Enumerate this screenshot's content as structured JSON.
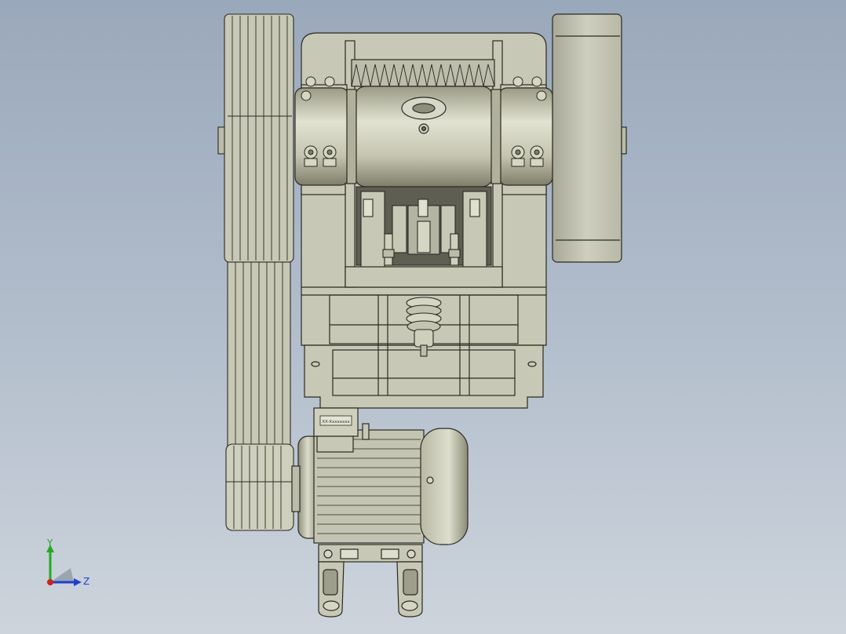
{
  "viewport": {
    "name": "graphics-area",
    "background_top": "#9aa8bb",
    "background_bottom": "#cdd4dc"
  },
  "model": {
    "name": "jaw-crusher-assembly",
    "body_color": "#c8c8b6",
    "edge_color": "#2a2a22",
    "motor_plate_text": "XX-Xxxxxxxx"
  },
  "triad": {
    "y_label": "Y",
    "z_label": "Z",
    "y_color": "#22aa22",
    "z_color": "#1f3fd0",
    "x_color": "#d02020"
  }
}
